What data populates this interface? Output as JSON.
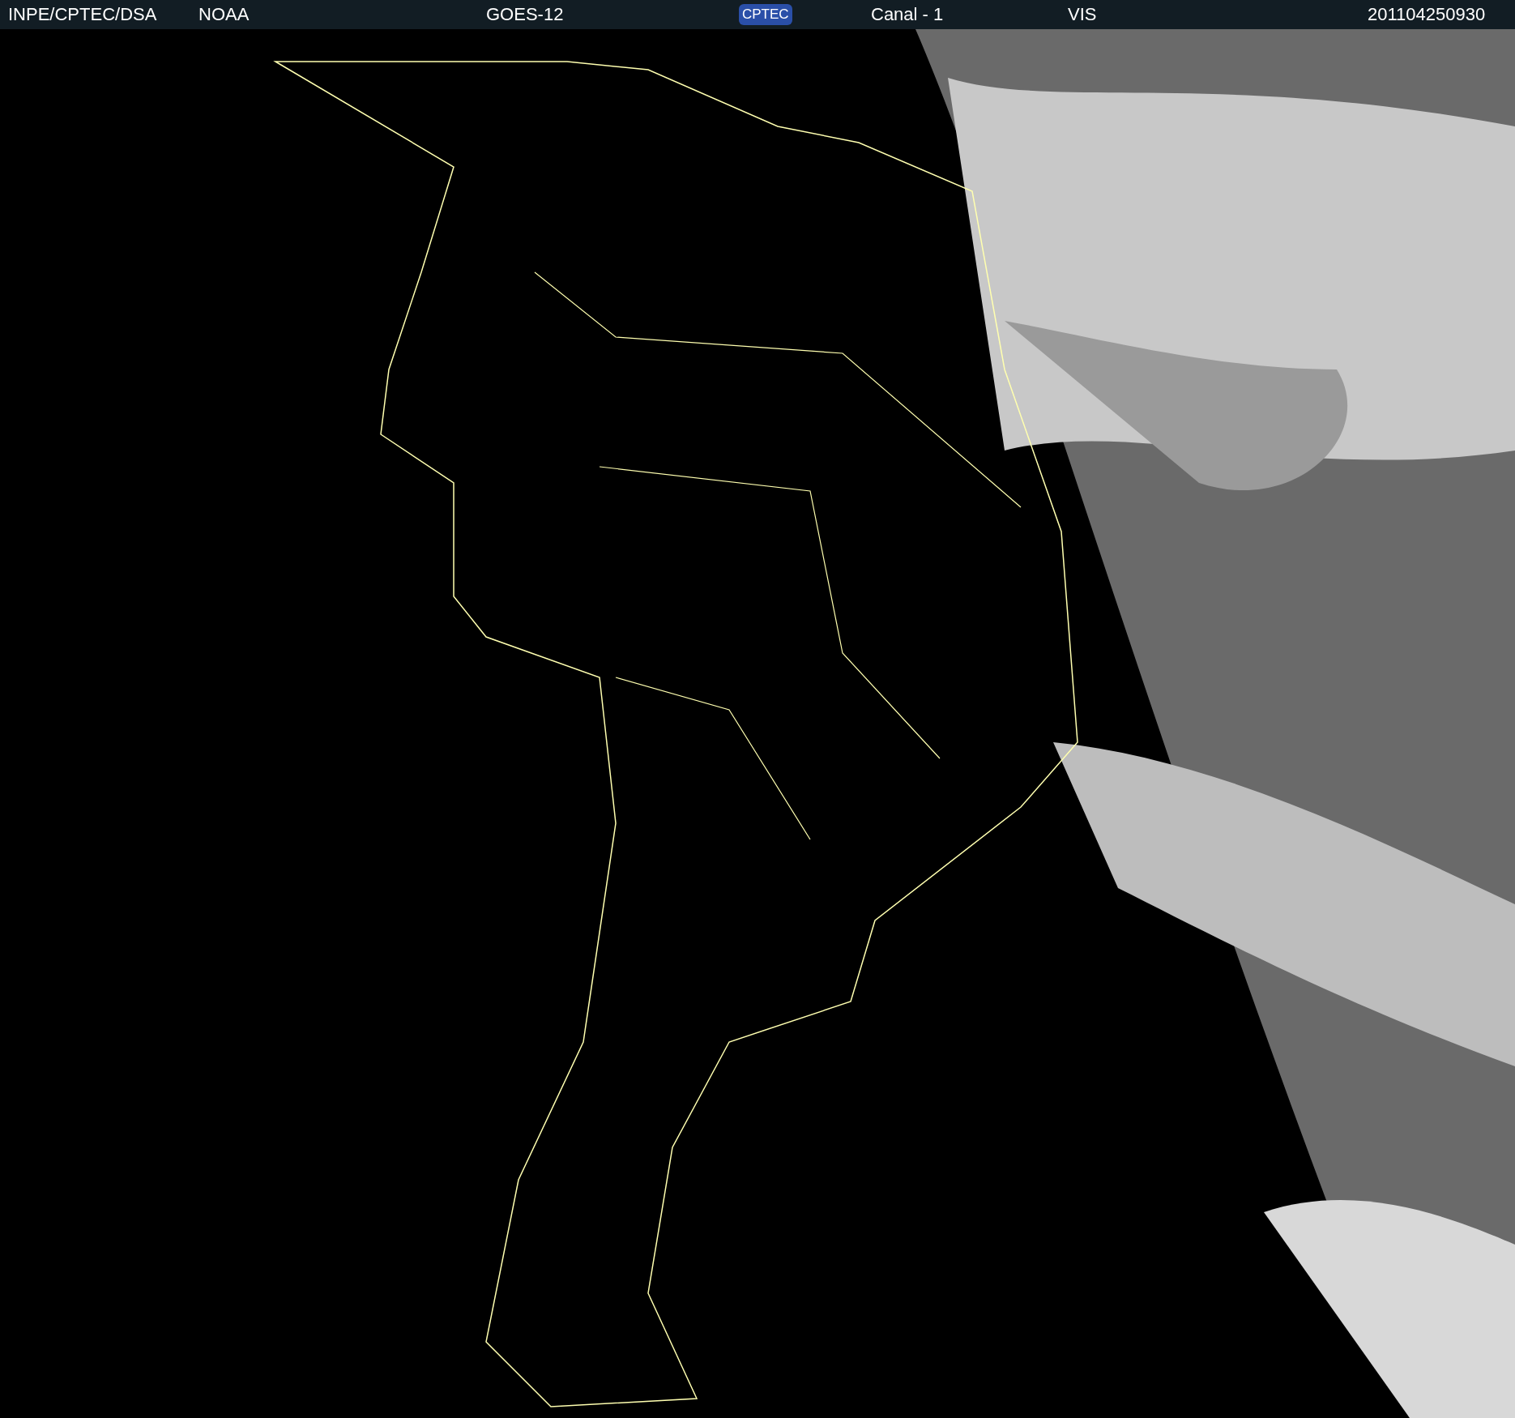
{
  "header": {
    "items": [
      {
        "kind": "text",
        "text": "INPE/CPTEC/DSA"
      },
      {
        "kind": "text",
        "text": "NOAA"
      },
      {
        "kind": "text",
        "text": "GOES-12"
      },
      {
        "kind": "logo",
        "text": "CPTEC"
      },
      {
        "kind": "text",
        "text": "Canal - 1"
      },
      {
        "kind": "text",
        "text": "VIS"
      },
      {
        "kind": "text",
        "text": "201104250930"
      }
    ]
  }
}
